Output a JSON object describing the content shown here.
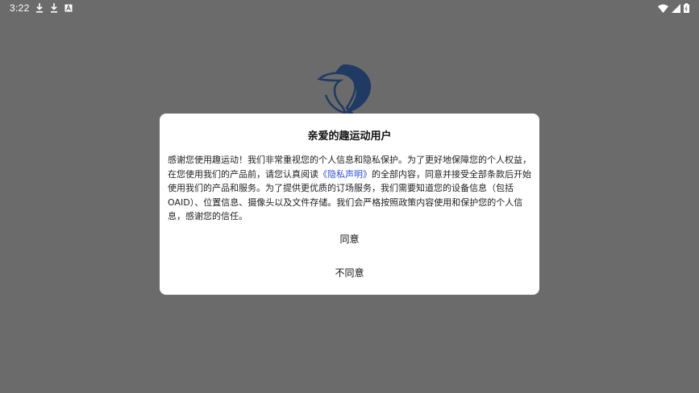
{
  "status_bar": {
    "time": "3:22",
    "left_icons": [
      "download-icon",
      "download-icon",
      "a-box-icon"
    ],
    "right_icons": [
      "wifi-icon",
      "signal-icon",
      "battery-icon"
    ]
  },
  "background": {
    "logo": "dolphin-logo-icon"
  },
  "dialog": {
    "title": "亲爱的趣运动用户",
    "body_before_link": "感谢您使用趣运动！我们非常重视您的个人信息和隐私保护。为了更好地保障您的个人权益，在您使用我们的产品前，请您认真阅读",
    "body_link": "《隐私声明》",
    "body_after_link": "的全部内容，同意并接受全部条款后开始使用我们的产品和服务。为了提供更优质的订场服务，我们需要知道您的设备信息（包括OAID）、位置信息、摄像头以及文件存储。我们会严格按照政策内容使用和保护您的个人信息，感谢您的信任。",
    "agree_label": "同意",
    "disagree_label": "不同意"
  },
  "colors": {
    "overlay": "#6b6b6b",
    "dialog_bg": "#ffffff",
    "link": "#2b4fd8",
    "logo": "#1f3a63"
  }
}
